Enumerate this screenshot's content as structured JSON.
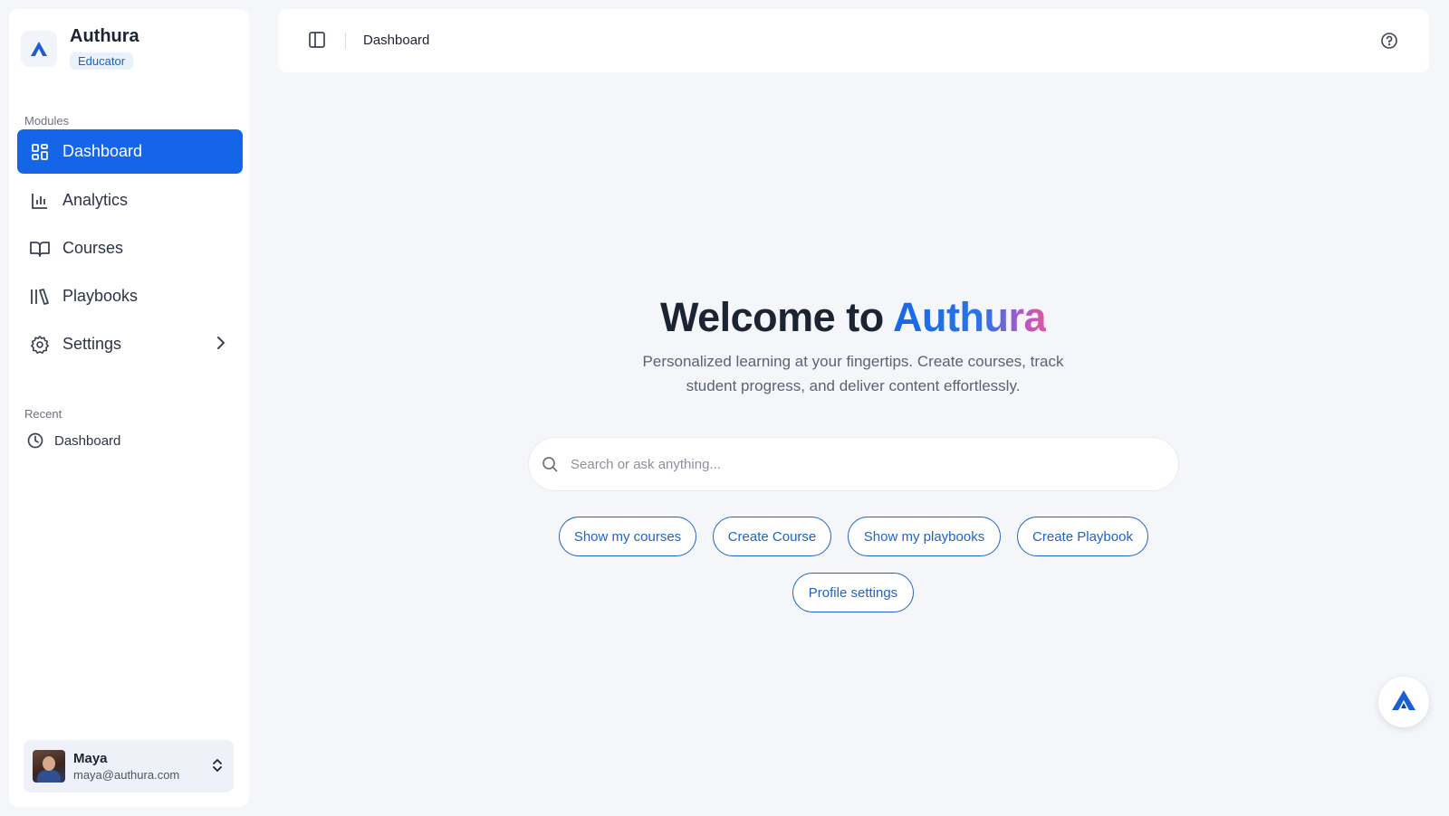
{
  "sidebar": {
    "brand_name": "Authura",
    "brand_badge": "Educator",
    "modules_label": "Modules",
    "items": [
      {
        "label": "Dashboard",
        "icon": "grid-icon",
        "active": true
      },
      {
        "label": "Analytics",
        "icon": "bar-chart-icon"
      },
      {
        "label": "Courses",
        "icon": "book-open-icon"
      },
      {
        "label": "Playbooks",
        "icon": "library-icon"
      },
      {
        "label": "Settings",
        "icon": "gear-icon"
      }
    ],
    "recent_label": "Recent",
    "recent_items": [
      {
        "label": "Dashboard",
        "icon": "clock-icon"
      }
    ],
    "user": {
      "name": "Maya",
      "email": "maya@authura.com"
    }
  },
  "header": {
    "breadcrumb": "Dashboard"
  },
  "hero": {
    "title_prefix": "Welcome to ",
    "title_brand": "Authura",
    "subtitle_line1": "Personalized learning at your fingertips. Create courses, track",
    "subtitle_line2": "student progress, and deliver content effortlessly."
  },
  "search": {
    "placeholder": "Search or ask anything...",
    "value": ""
  },
  "chips": [
    "Show my courses",
    "Create Course",
    "Show my playbooks",
    "Create Playbook",
    "Profile settings"
  ],
  "colors": {
    "accent": "#1565e9",
    "chip_border": "#1f63c8",
    "background": "#f4f6fa"
  }
}
